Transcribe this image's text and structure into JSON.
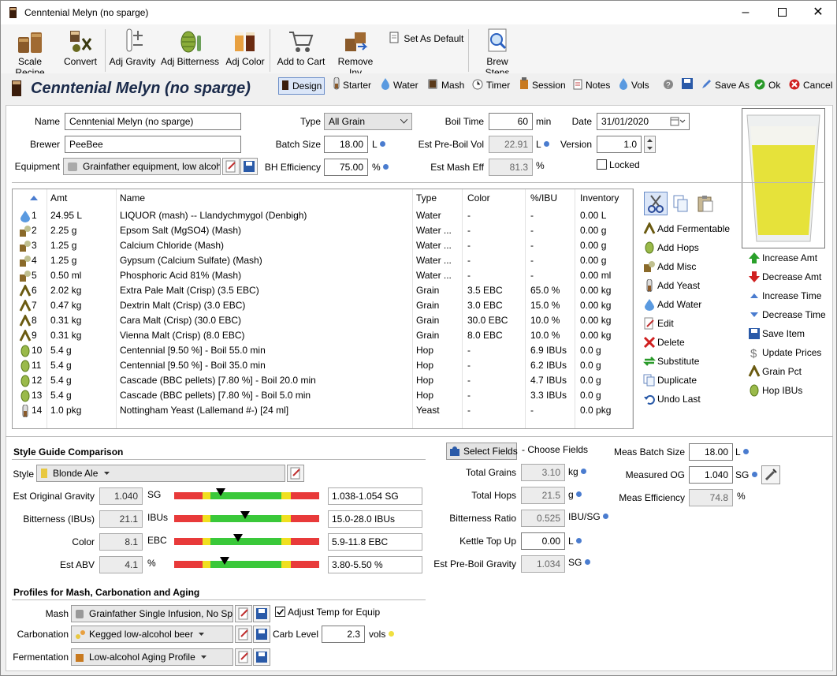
{
  "window": {
    "title": "Cenntenial Melyn (no sparge)"
  },
  "ribbon": {
    "scale_recipe": "Scale Recipe",
    "convert": "Convert",
    "adj_gravity": "Adj Gravity",
    "adj_bitterness": "Adj Bitterness",
    "adj_color": "Adj Color",
    "add_to_cart": "Add to Cart",
    "remove_inv": "Remove Inv",
    "set_as_default": "Set As Default",
    "brew_steps": "Brew Steps"
  },
  "toolbar": {
    "recipe_title": "Cenntenial Melyn (no sparge)",
    "design": "Design",
    "starter": "Starter",
    "water": "Water",
    "mash": "Mash",
    "timer": "Timer",
    "session": "Session",
    "notes": "Notes",
    "vols": "Vols",
    "save_as": "Save As",
    "ok": "Ok",
    "cancel": "Cancel"
  },
  "form": {
    "name_label": "Name",
    "name_value": "Cenntenial Melyn (no sparge)",
    "brewer_label": "Brewer",
    "brewer_value": "PeeBee",
    "equipment_label": "Equipment",
    "equipment_value": "Grainfather equipment, low alcoh",
    "type_label": "Type",
    "type_value": "All Grain",
    "batch_size_label": "Batch Size",
    "batch_size_value": "18.00",
    "batch_size_unit": "L",
    "bh_eff_label": "BH Efficiency",
    "bh_eff_value": "75.00",
    "bh_eff_unit": "%",
    "boil_time_label": "Boil Time",
    "boil_time_value": "60",
    "boil_time_unit": "min",
    "pre_boil_vol_label": "Est Pre-Boil Vol",
    "pre_boil_vol_value": "22.91",
    "pre_boil_vol_unit": "L",
    "mash_eff_label": "Est Mash Eff",
    "mash_eff_value": "81.3",
    "mash_eff_unit": "%",
    "date_label": "Date",
    "date_value": "31/01/2020",
    "version_label": "Version",
    "version_value": "1.0",
    "locked_label": "Locked"
  },
  "table": {
    "headers": [
      "Amt",
      "Name",
      "Type",
      "Color",
      "%/IBU",
      "Inventory"
    ],
    "rows": [
      {
        "n": "1",
        "amt": "24.95 L",
        "name": "LIQUOR (mash) -- Llandychmygol (Denbigh)",
        "type": "Water",
        "color": "-",
        "pct": "-",
        "inv": "0.00 L",
        "icon": "water"
      },
      {
        "n": "2",
        "amt": "2.25 g",
        "name": "Epsom Salt (MgSO4) (Mash)",
        "type": "Water ...",
        "color": "-",
        "pct": "-",
        "inv": "0.00 g",
        "icon": "misc"
      },
      {
        "n": "3",
        "amt": "1.25 g",
        "name": "Calcium Chloride (Mash)",
        "type": "Water ...",
        "color": "-",
        "pct": "-",
        "inv": "0.00 g",
        "icon": "misc"
      },
      {
        "n": "4",
        "amt": "1.25 g",
        "name": "Gypsum (Calcium Sulfate) (Mash)",
        "type": "Water ...",
        "color": "-",
        "pct": "-",
        "inv": "0.00 g",
        "icon": "misc"
      },
      {
        "n": "5",
        "amt": "0.50 ml",
        "name": "Phosphoric Acid 81% (Mash)",
        "type": "Water ...",
        "color": "-",
        "pct": "-",
        "inv": "0.00 ml",
        "icon": "misc"
      },
      {
        "n": "6",
        "amt": "2.02 kg",
        "name": "Extra Pale Malt (Crisp) (3.5 EBC)",
        "type": "Grain",
        "color": "3.5 EBC",
        "pct": "65.0 %",
        "inv": "0.00 kg",
        "icon": "grain"
      },
      {
        "n": "7",
        "amt": "0.47 kg",
        "name": "Dextrin Malt (Crisp) (3.0 EBC)",
        "type": "Grain",
        "color": "3.0 EBC",
        "pct": "15.0 %",
        "inv": "0.00 kg",
        "icon": "grain"
      },
      {
        "n": "8",
        "amt": "0.31 kg",
        "name": "Cara Malt (Crisp) (30.0 EBC)",
        "type": "Grain",
        "color": "30.0 EBC",
        "pct": "10.0 %",
        "inv": "0.00 kg",
        "icon": "grain"
      },
      {
        "n": "9",
        "amt": "0.31 kg",
        "name": "Vienna Malt (Crisp) (8.0 EBC)",
        "type": "Grain",
        "color": "8.0 EBC",
        "pct": "10.0 %",
        "inv": "0.00 kg",
        "icon": "grain"
      },
      {
        "n": "10",
        "amt": "5.4 g",
        "name": "Centennial [9.50 %] - Boil 55.0 min",
        "type": "Hop",
        "color": "-",
        "pct": "6.9 IBUs",
        "inv": "0.0 g",
        "icon": "hop"
      },
      {
        "n": "11",
        "amt": "5.4 g",
        "name": "Centennial [9.50 %] - Boil 35.0 min",
        "type": "Hop",
        "color": "-",
        "pct": "6.2 IBUs",
        "inv": "0.0 g",
        "icon": "hop"
      },
      {
        "n": "12",
        "amt": "5.4 g",
        "name": "Cascade (BBC pellets) [7.80 %] - Boil 20.0 min",
        "type": "Hop",
        "color": "-",
        "pct": "4.7 IBUs",
        "inv": "0.0 g",
        "icon": "hop"
      },
      {
        "n": "13",
        "amt": "5.4 g",
        "name": "Cascade (BBC pellets) [7.80 %] - Boil 5.0 min",
        "type": "Hop",
        "color": "-",
        "pct": "3.3 IBUs",
        "inv": "0.0 g",
        "icon": "hop"
      },
      {
        "n": "14",
        "amt": "1.0 pkg",
        "name": "Nottingham Yeast (Lallemand #-) [24 ml]",
        "type": "Yeast",
        "color": "-",
        "pct": "-",
        "inv": "0.0 pkg",
        "icon": "yeast"
      }
    ]
  },
  "actions": {
    "add_fermentable": "Add Fermentable",
    "add_hops": "Add Hops",
    "add_misc": "Add Misc",
    "add_yeast": "Add Yeast",
    "add_water": "Add Water",
    "edit": "Edit",
    "delete": "Delete",
    "substitute": "Substitute",
    "duplicate": "Duplicate",
    "undo_last": "Undo Last",
    "increase_amt": "Increase Amt",
    "decrease_amt": "Decrease Amt",
    "increase_time": "Increase Time",
    "decrease_time": "Decrease Time",
    "save_item": "Save Item",
    "update_prices": "Update Prices",
    "grain_pct": "Grain Pct",
    "hop_ibus": "Hop IBUs"
  },
  "style": {
    "section_title": "Style Guide Comparison",
    "style_label": "Style",
    "style_value": "Blonde Ale",
    "og_label": "Est Original Gravity",
    "og_value": "1.040",
    "og_unit": "SG",
    "og_range": "1.038-1.054 SG",
    "og_pos": 0.32,
    "ibu_label": "Bitterness (IBUs)",
    "ibu_value": "21.1",
    "ibu_unit": "IBUs",
    "ibu_range": "15.0-28.0 IBUs",
    "ibu_pos": 0.49,
    "color_label": "Color",
    "color_value": "8.1",
    "color_unit": "EBC",
    "color_range": "5.9-11.8 EBC",
    "color_pos": 0.44,
    "abv_label": "Est ABV",
    "abv_value": "4.1",
    "abv_unit": "%",
    "abv_range": "3.80-5.50 %",
    "abv_pos": 0.35
  },
  "fields": {
    "select_fields": "Select Fields",
    "choose_fields": "- Choose Fields",
    "total_grains_label": "Total Grains",
    "total_grains_value": "3.10",
    "total_grains_unit": "kg",
    "total_hops_label": "Total Hops",
    "total_hops_value": "21.5",
    "total_hops_unit": "g",
    "bitterness_ratio_label": "Bitterness Ratio",
    "bitterness_ratio_value": "0.525",
    "bitterness_ratio_unit": "IBU/SG",
    "kettle_top_up_label": "Kettle Top Up",
    "kettle_top_up_value": "0.00",
    "kettle_top_up_unit": "L",
    "pre_boil_gravity_label": "Est Pre-Boil Gravity",
    "pre_boil_gravity_value": "1.034",
    "pre_boil_gravity_unit": "SG"
  },
  "meas": {
    "batch_label": "Meas Batch Size",
    "batch_value": "18.00",
    "batch_unit": "L",
    "og_label": "Measured OG",
    "og_value": "1.040",
    "og_unit": "SG",
    "eff_label": "Meas Efficiency",
    "eff_value": "74.8",
    "eff_unit": "%"
  },
  "profiles": {
    "section_title": "Profiles for Mash, Carbonation and Aging",
    "mash_label": "Mash",
    "mash_value": "Grainfather Single Infusion, No Spa",
    "adjust_temp_label": "Adjust Temp for Equip",
    "carb_label": "Carbonation",
    "carb_value": "Kegged low-alcohol beer",
    "carb_level_label": "Carb Level",
    "carb_level_value": "2.3",
    "carb_level_unit": "vols",
    "ferm_label": "Fermentation",
    "ferm_value": "Low-alcohol Aging Profile"
  }
}
